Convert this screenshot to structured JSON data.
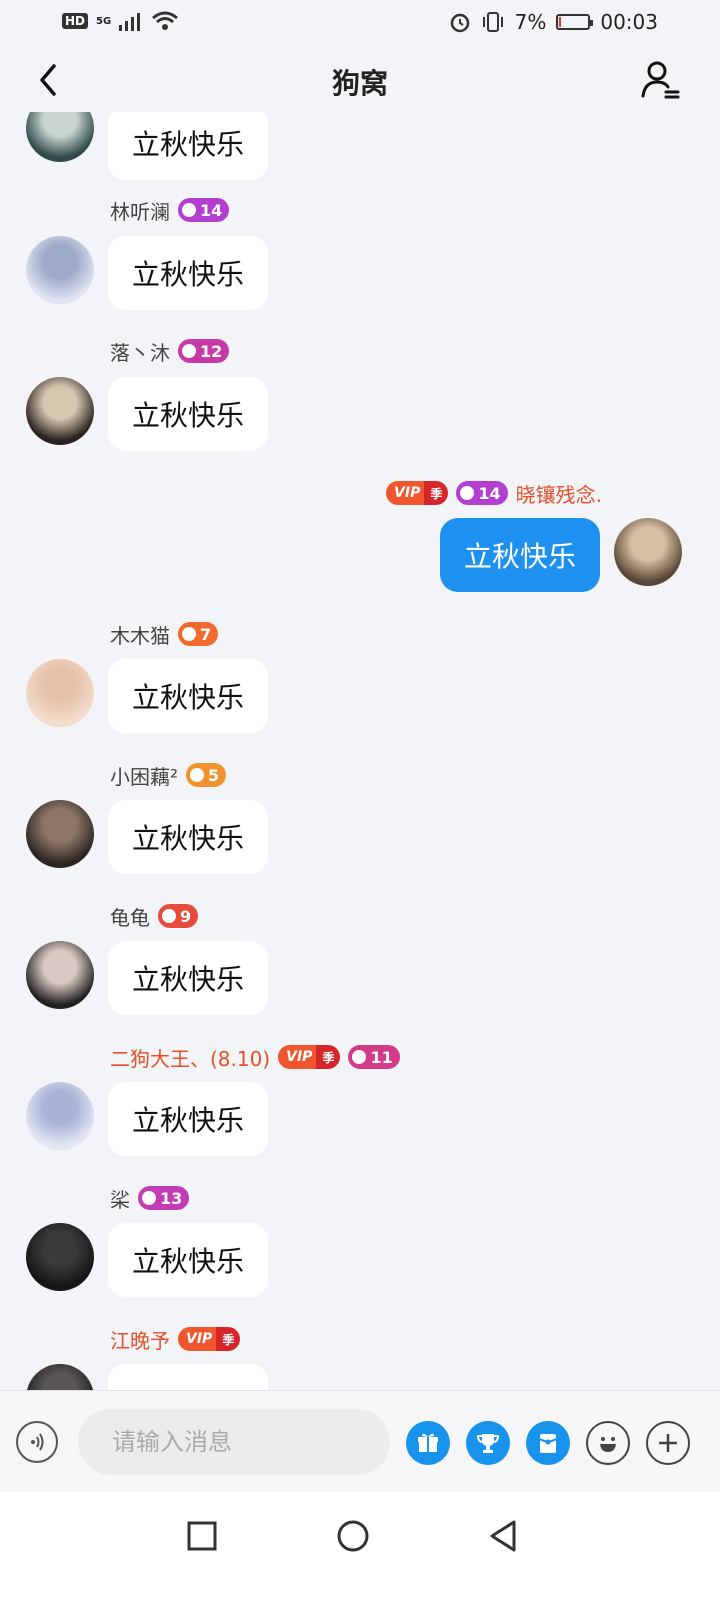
{
  "status_bar": {
    "hd": "HD",
    "network": "5G",
    "battery_text": "7%",
    "battery_level": 0.07,
    "time": "00:03"
  },
  "header": {
    "title": "狗窝"
  },
  "messages": [
    {
      "sender": "",
      "text": "立秋快乐",
      "mine": false
    },
    {
      "sender": "林听澜",
      "level": "14",
      "level_color": "#b33fd0",
      "text": "立秋快乐",
      "mine": false
    },
    {
      "sender": "落丶沐",
      "level": "12",
      "level_color": "#c63aa8",
      "text": "立秋快乐",
      "mine": false
    },
    {
      "sender": "晓镶残念.",
      "level": "14",
      "level_color": "#b33fd0",
      "vip": true,
      "vip_label": "VIP",
      "vip_season": "季",
      "text": "立秋快乐",
      "mine": true
    },
    {
      "sender": "木木猫",
      "level": "7",
      "level_color": "#ee6b2d",
      "text": "立秋快乐",
      "mine": false
    },
    {
      "sender": "小困藕²",
      "level": "5",
      "level_color": "#f0932e",
      "text": "立秋快乐",
      "mine": false
    },
    {
      "sender": "龟龟",
      "level": "9",
      "level_color": "#e84a3c",
      "text": "立秋快乐",
      "mine": false
    },
    {
      "sender": "二狗大王、(8.10)",
      "level": "11",
      "level_color": "#d43a8a",
      "vip": true,
      "vip_label": "VIP",
      "vip_season": "季",
      "text": "立秋快乐",
      "mine": false
    },
    {
      "sender": "桬",
      "level": "13",
      "level_color": "#c23cb8",
      "text": "立秋快乐",
      "mine": false
    },
    {
      "sender": "江晚予",
      "vip": true,
      "vip_label": "VIP",
      "vip_season": "季",
      "text": "",
      "mine": false
    }
  ],
  "input": {
    "placeholder": "请输入消息"
  },
  "icons": {
    "back": "back-arrow-icon",
    "members": "group-members-icon",
    "voice": "voice-icon",
    "gift": "gift-icon",
    "trophy": "trophy-icon",
    "redpacket": "red-packet-icon",
    "emoji": "emoji-icon",
    "plus": "plus-icon"
  },
  "colors": {
    "bubble_mine": "#1e90f0",
    "bubble_other": "#ffffff",
    "vip_name": "#e4502a",
    "background": "#f3f4f7"
  }
}
